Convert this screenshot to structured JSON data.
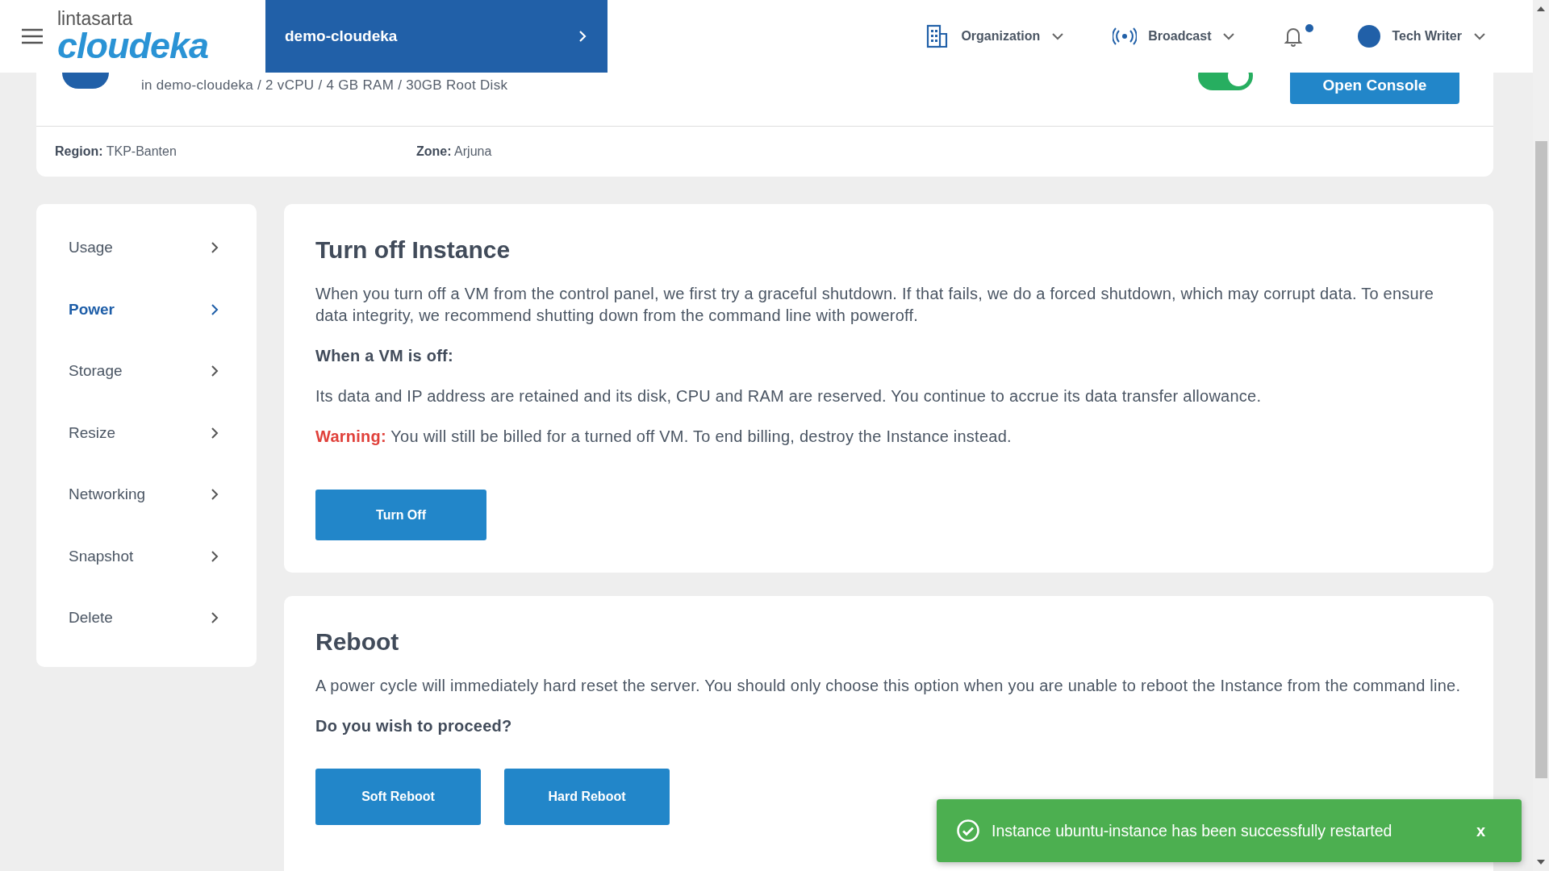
{
  "header": {
    "brand_top": "lintasarta",
    "brand_main": "cloudeka",
    "project": "demo-cloudeka",
    "nav": [
      {
        "label": "Organization"
      },
      {
        "label": "Broadcast"
      }
    ],
    "notifications": {
      "unread": true
    },
    "user": "Tech Writer"
  },
  "instance": {
    "details": "in demo-cloudeka / 2 vCPU / 4 GB RAM / 30GB Root Disk",
    "power_on": true,
    "console_button": "Open Console",
    "region_label": "Region:",
    "region": "TKP-Banten",
    "zone_label": "Zone:",
    "zone": "Arjuna"
  },
  "sidebar": {
    "items": [
      {
        "label": "Usage",
        "selected": false
      },
      {
        "label": "Power",
        "selected": true
      },
      {
        "label": "Storage",
        "selected": false
      },
      {
        "label": "Resize",
        "selected": false
      },
      {
        "label": "Networking",
        "selected": false
      },
      {
        "label": "Snapshot",
        "selected": false
      },
      {
        "label": "Delete",
        "selected": false
      }
    ]
  },
  "turn_off": {
    "title": "Turn off Instance",
    "description": "When you turn off a VM from the control panel, we first try a graceful shutdown. If that fails, we do a forced shutdown, which may corrupt data. To ensure data integrity, we recommend shutting down from the command line with poweroff.",
    "subheading": "When a VM is off:",
    "detail": "Its data and IP address are retained and its disk, CPU and RAM are reserved. You continue to accrue its data transfer allowance.",
    "warning_label": "Warning:",
    "warning": "You will still be billed for a turned off VM. To end billing, destroy the Instance instead.",
    "button": "Turn Off"
  },
  "reboot": {
    "title": "Reboot",
    "description": "A power cycle will immediately hard reset the server. You should only choose this option when you are unable to reboot the Instance from the command line.",
    "question": "Do you wish to proceed?",
    "buttons": [
      "Soft Reboot",
      "Hard Reboot"
    ]
  },
  "toast": {
    "message": "Instance ubuntu-instance has been successfully restarted",
    "close": "x"
  }
}
